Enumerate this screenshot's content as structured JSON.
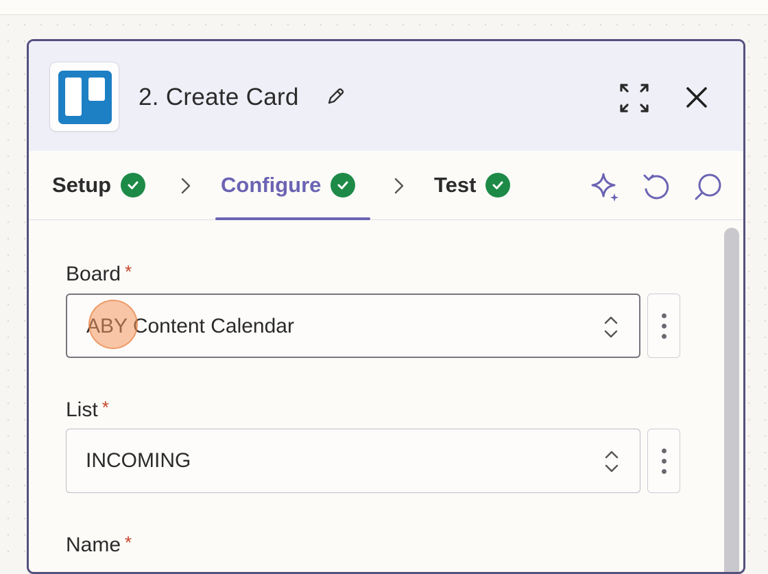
{
  "step": {
    "title": "2. Create Card",
    "app_icon": "trello-logo",
    "edit_icon": "pencil-icon",
    "expand_icon": "expand-icon",
    "close_icon": "close-icon"
  },
  "tabs": [
    {
      "label": "Setup",
      "status": "complete"
    },
    {
      "label": "Configure",
      "status": "complete",
      "active": true
    },
    {
      "label": "Test",
      "status": "complete"
    }
  ],
  "toolbar": {
    "ai_icon": "sparkle-icon",
    "undo_icon": "refresh-icon",
    "comment_icon": "comment-icon"
  },
  "fields": {
    "board": {
      "label": "Board",
      "required_mark": "*",
      "value": "ABY Content Calendar"
    },
    "list": {
      "label": "List",
      "required_mark": "*",
      "value": "INCOMING"
    },
    "name": {
      "label": "Name",
      "required_mark": "*"
    }
  },
  "colors": {
    "accent": "#6b64b3",
    "success": "#1e8a47",
    "required": "#c9462a",
    "trello_blue": "#1d7fc4",
    "panel_border": "#54507e"
  }
}
